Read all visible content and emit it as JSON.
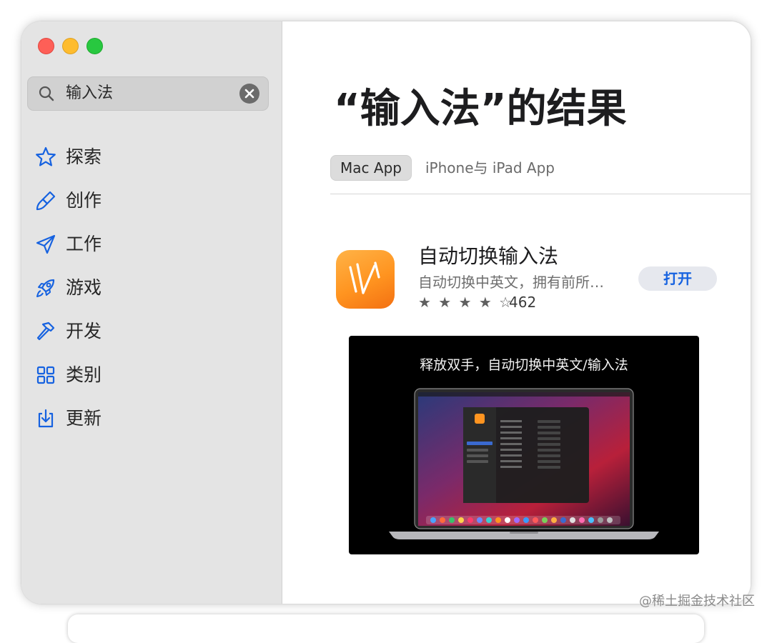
{
  "colors": {
    "sidebar_bg": "#e4e4e4",
    "accent": "#1662e0",
    "traffic_red": "#fe5f57",
    "traffic_yellow": "#febc2e",
    "traffic_green": "#28c840",
    "app_icon": "#ff9420"
  },
  "window_controls": [
    "close",
    "minimize",
    "zoom"
  ],
  "search": {
    "value": "输入法",
    "icon": "magnifier-icon",
    "clear_icon": "clear-x-icon"
  },
  "sidebar": {
    "items": [
      {
        "label": "探索",
        "icon": "star-icon"
      },
      {
        "label": "创作",
        "icon": "brush-icon"
      },
      {
        "label": "工作",
        "icon": "paperplane-icon"
      },
      {
        "label": "游戏",
        "icon": "rocket-icon"
      },
      {
        "label": "开发",
        "icon": "hammer-icon"
      },
      {
        "label": "类别",
        "icon": "grid-icon"
      },
      {
        "label": "更新",
        "icon": "download-icon"
      }
    ]
  },
  "main": {
    "title": "“输入法”的结果",
    "tabs": [
      {
        "label": "Mac App",
        "selected": true
      },
      {
        "label": "iPhone与 iPad App",
        "selected": false
      }
    ]
  },
  "app": {
    "name": "自动切换输入法",
    "subtitle": "自动切换中英文，拥有前所…",
    "stars": "★ ★ ★ ★ ☆",
    "rating_value": 4,
    "rating_max": 5,
    "rating_count": "462",
    "open_label": "打开",
    "screenshot_caption": "释放双手，自动切换中英文/输入法"
  },
  "watermark": "@稀土掘金技术社区"
}
